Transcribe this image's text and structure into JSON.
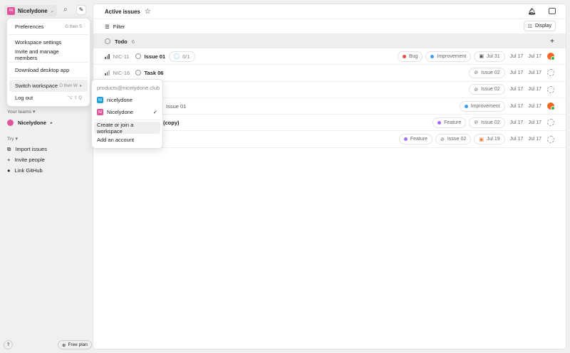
{
  "workspace": {
    "name": "Nicelydone",
    "initials": "NI",
    "color": "#e0559a"
  },
  "header": {
    "title": "Active issues",
    "filter": "Filter",
    "display": "Display"
  },
  "group": {
    "label": "Todo",
    "count": "6"
  },
  "rows": [
    {
      "id": "NIC-11",
      "title": "Issue 01",
      "sub": "0/1",
      "chips": [
        {
          "t": "Bug",
          "c": "#eb4d4d"
        },
        {
          "t": "Improvement",
          "c": "#3d9df5"
        }
      ],
      "due": "Jul 31",
      "dueColor": "#555",
      "d1": "Jul 17",
      "d2": "Jul 17",
      "assigned": true
    },
    {
      "id": "NIC-16",
      "title": "Task 06",
      "chips": [],
      "parent": "Issue 02",
      "d1": "Jul 17",
      "d2": "Jul 17",
      "assigned": false
    },
    {
      "chips": [],
      "parent": "Issue 02",
      "d1": "Jul 17",
      "d2": "Jul 17",
      "assigned": false
    },
    {
      "partial": "Issue 01",
      "chips": [
        {
          "t": "Improvement",
          "c": "#3d9df5"
        }
      ],
      "d1": "Jul 17",
      "d2": "Jul 17",
      "assigned": true
    },
    {
      "partial": "(copy)",
      "chips": [
        {
          "t": "Feature",
          "c": "#a66ef0"
        }
      ],
      "parent": "Issue 02",
      "d1": "Jul 17",
      "d2": "Jul 17",
      "assigned": false
    },
    {
      "chips": [
        {
          "t": "Feature",
          "c": "#a66ef0"
        }
      ],
      "parent": "Issue 02",
      "due": "Jul 19",
      "dueColor": "#f07a3a",
      "d1": "Jul 17",
      "d2": "Jul 17",
      "assigned": false
    }
  ],
  "menu": {
    "items": [
      {
        "label": "Preferences",
        "shortcut": "G then S"
      },
      {
        "label": "Workspace settings"
      },
      {
        "label": "Invite and manage members"
      },
      {
        "label": "Download desktop app"
      },
      {
        "label": "Switch workspace",
        "shortcut": "O then W"
      },
      {
        "label": "Log out",
        "shortcut": "⌥ ⇧ Q"
      }
    ]
  },
  "submenu": {
    "email": "products@nicelydone.club",
    "workspaces": [
      {
        "name": "nicelydone",
        "initials": "NI",
        "color": "#1e9fd6"
      },
      {
        "name": "Nicelydone",
        "initials": "NI",
        "color": "#e0559a"
      }
    ],
    "create": "Create or join a workspace",
    "add": "Add an account"
  },
  "sidebar": {
    "teams_label": "Your teams",
    "team": "Nicelydone",
    "try_label": "Try",
    "try_items": [
      "Import issues",
      "Invite people",
      "Link GitHub"
    ],
    "help": "?",
    "plan": "Free plan"
  }
}
